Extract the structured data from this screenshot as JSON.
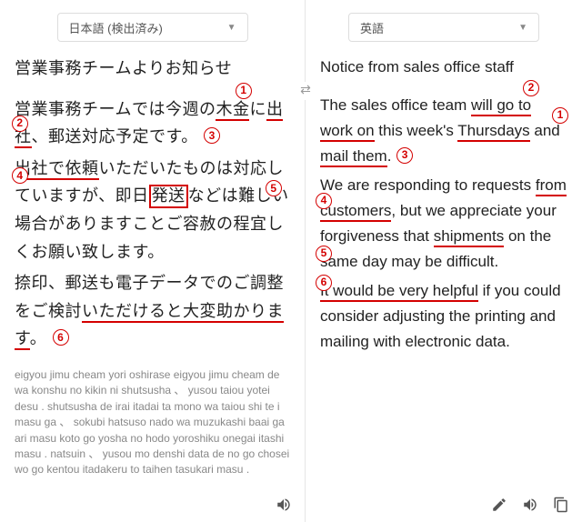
{
  "left": {
    "lang": "日本語 (検出済み)",
    "title": "営業事務チームよりお知らせ",
    "p1_a": "営業事務チームでは今週の",
    "p1_u1": "木金",
    "p1_b": "に",
    "p1_u2": "出社",
    "p1_c": "、郵送対応予定です。",
    "p2_u1": "出社で依頼",
    "p2_a": "いただいたものは対応していますが、即日",
    "p2_box": "発送",
    "p2_b": "などは難しい場合がありますことご容赦の程宜しくお願い致します。",
    "p3_a": "捺印、郵送も電子データでのご調整をご検討",
    "p3_u1": "いただけると大変助かります",
    "p3_b": "。",
    "romaji": "eigyou jimu cheam yori oshirase eigyou jimu cheam de wa konshu no kikin ni shutsusha 、  yusou taiou yotei desu . shutsusha de irai itadai ta mono wa taiou shi te i masu ga 、 sokubi hatsuso nado wa muzukashi baai ga ari masu koto go yosha no hodo yoroshiku onegai itashi masu . natsuin 、  yusou mo denshi data de no go chosei wo go kentou itadakeru to taihen tasukari masu ."
  },
  "right": {
    "lang": "英語",
    "title": "Notice from sales office staff",
    "p1_a": "The sales office team ",
    "p1_u1": "will go to work on",
    "p1_b": " this week's ",
    "p1_u2": "Thursdays",
    "p1_c": " and ",
    "p1_u3": "mail them",
    "p1_d": ". ",
    "p2_a": "We are responding to requests ",
    "p2_u1": "from customers",
    "p2_b": ", but we appreciate your forgiveness that ",
    "p2_u2": "shipments",
    "p2_c": " on the same day may be difficult.",
    "p3_u1": "It would be very helpful",
    "p3_a": " if you could consider adjusting the printing and mailing with electronic data."
  },
  "nums": {
    "n1": "1",
    "n2": "2",
    "n3": "3",
    "n4": "4",
    "n5": "5",
    "n6": "6"
  }
}
